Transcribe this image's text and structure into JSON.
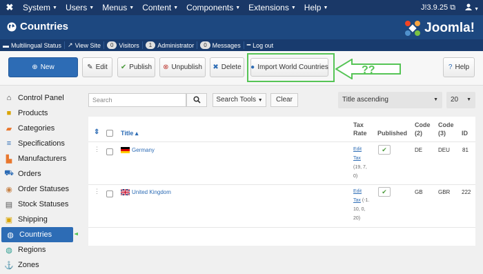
{
  "topnav": {
    "logo": "✖",
    "menu": [
      "System",
      "Users",
      "Menus",
      "Content",
      "Components",
      "Extensions",
      "Help"
    ],
    "version": "J!3.9.25 ⧉",
    "user_icon": "user-icon"
  },
  "header": {
    "title": "Countries",
    "brand": "Joomla!"
  },
  "statusbar": {
    "multilingual": "Multilingual Status",
    "view_site": "View Site",
    "visitors_count": "0",
    "visitors": "Visitors",
    "admin_count": "1",
    "admin": "Administrator",
    "messages_count": "0",
    "messages": "Messages",
    "logout": "Log out"
  },
  "toolbar": {
    "new": "New",
    "edit": "Edit",
    "publish": "Publish",
    "unpublish": "Unpublish",
    "delete": "Delete",
    "import": "Import World Countries",
    "help": "Help"
  },
  "annotation": {
    "question": "??"
  },
  "sidebar": {
    "items": [
      {
        "label": "Control Panel",
        "icon": "home-icon"
      },
      {
        "label": "Products",
        "icon": "box-icon"
      },
      {
        "label": "Categories",
        "icon": "folder-icon"
      },
      {
        "label": "Specifications",
        "icon": "sliders-icon"
      },
      {
        "label": "Manufacturers",
        "icon": "building-icon"
      },
      {
        "label": "Orders",
        "icon": "cart-icon"
      },
      {
        "label": "Order Statuses",
        "icon": "status-icon"
      },
      {
        "label": "Stock Statuses",
        "icon": "stack-icon"
      },
      {
        "label": "Shipping",
        "icon": "package-icon"
      },
      {
        "label": "Countries",
        "icon": "globe-icon"
      },
      {
        "label": "Regions",
        "icon": "globe-icon"
      },
      {
        "label": "Zones",
        "icon": "anchor-icon"
      }
    ],
    "active": "Countries"
  },
  "filters": {
    "search_placeholder": "Search",
    "search_tools": "Search Tools",
    "clear": "Clear",
    "sort": "Title ascending",
    "limit": "20"
  },
  "table": {
    "headers": {
      "sort_arrows": "⇕",
      "title": "Title ▴",
      "tax_rate_1": "Tax",
      "tax_rate_2": "Rate",
      "published": "Published",
      "code2_1": "Code",
      "code2_2": "(2)",
      "code3_1": "Code",
      "code3_2": "(3)",
      "id": "ID"
    },
    "rows": [
      {
        "flag": "de",
        "title": "Germany",
        "tax_link_1": "Edit",
        "tax_link_2": "Tax",
        "tax_vals_1": "(19, 7,",
        "tax_vals_2": "0)",
        "tax_vals_3": "",
        "published": "✔",
        "code2": "DE",
        "code3": "DEU",
        "id": "81"
      },
      {
        "flag": "gb",
        "title": "United Kingdom",
        "tax_link_1": "Edit",
        "tax_link_2": "Tax",
        "tax_vals_1": "(-1.",
        "tax_vals_2": "10, 0,",
        "tax_vals_3": "20)",
        "published": "✔",
        "code2": "GB",
        "code3": "GBR",
        "id": "222"
      }
    ]
  },
  "colors": {
    "topnav": "#1a3867",
    "header": "#1d4880",
    "accent": "#2d6cb5",
    "annotation": "#55c455"
  }
}
